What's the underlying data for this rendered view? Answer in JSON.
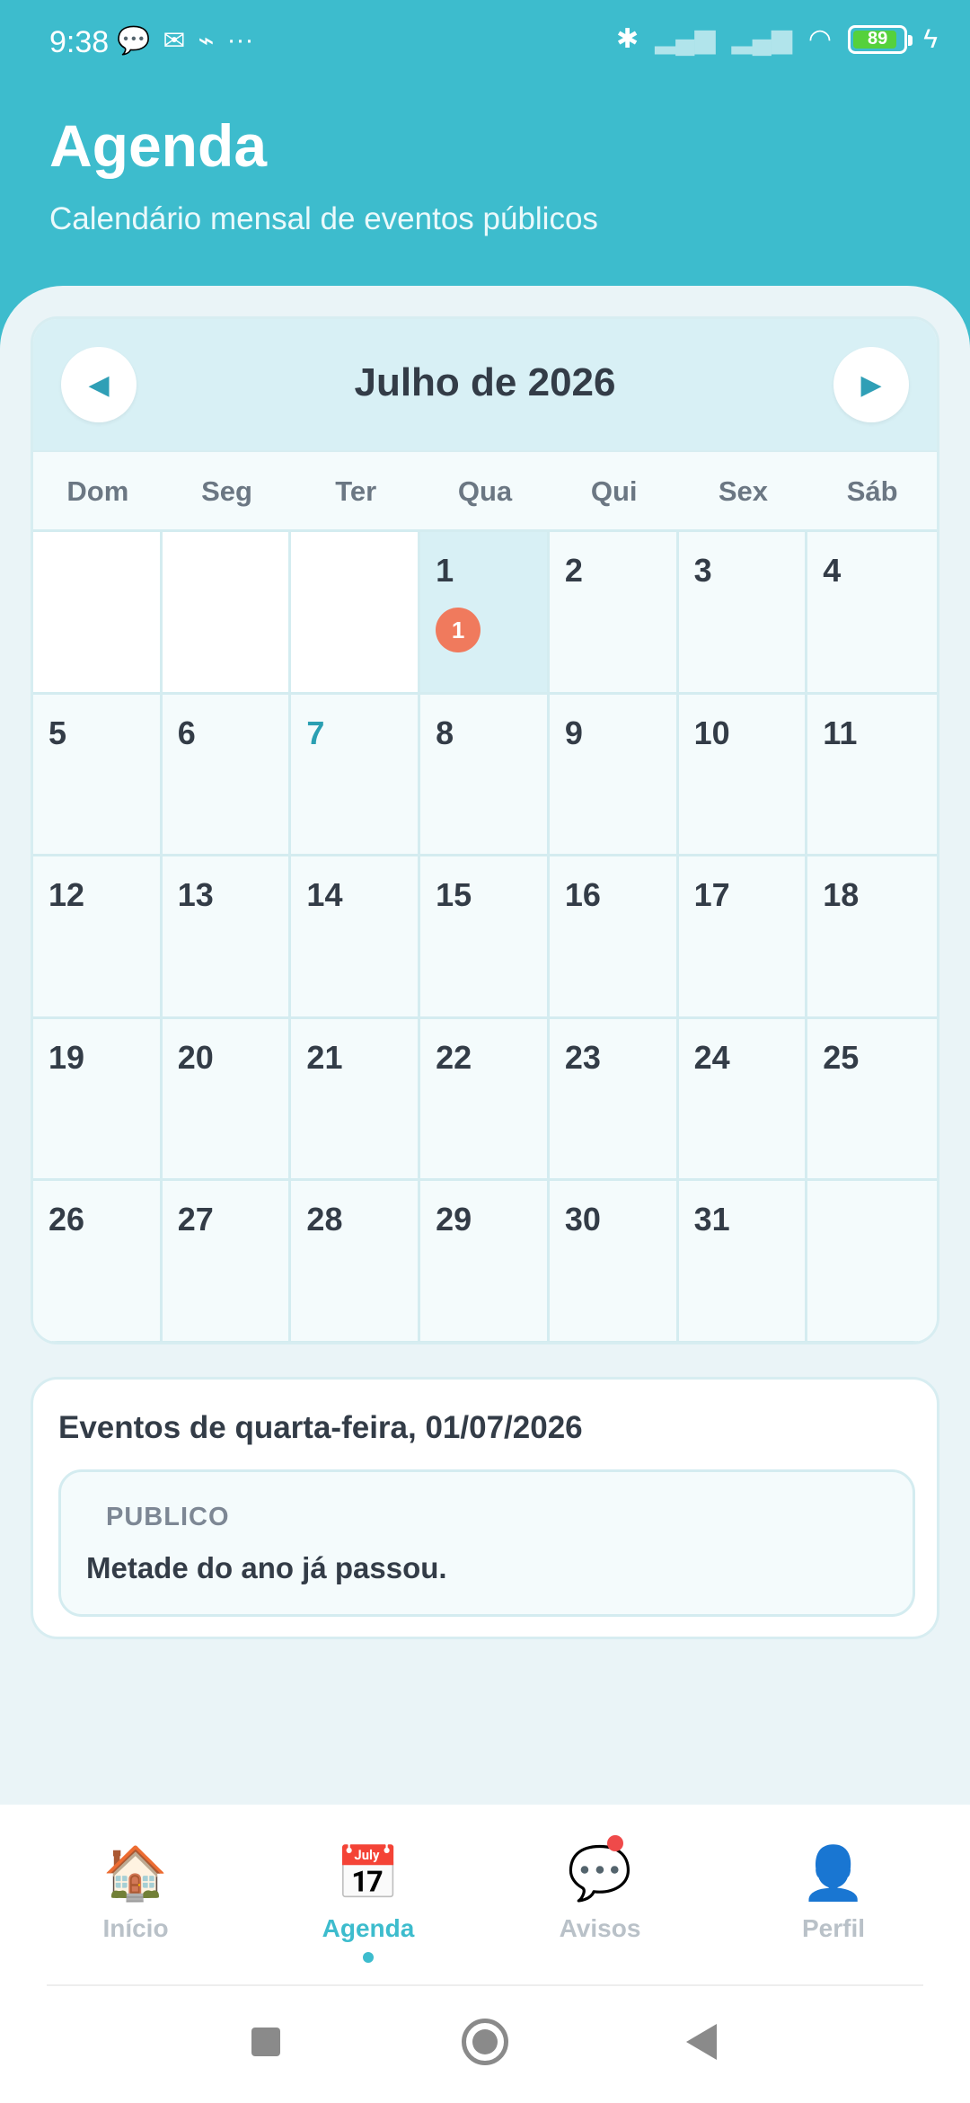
{
  "status_bar": {
    "time": "9:38",
    "battery": "89"
  },
  "header": {
    "title": "Agenda",
    "subtitle": "Calendário mensal de eventos públicos"
  },
  "calendar": {
    "month_label": "Julho de 2026",
    "prev_icon": "◀",
    "next_icon": "▶",
    "weekdays": [
      "Dom",
      "Seg",
      "Ter",
      "Qua",
      "Qui",
      "Sex",
      "Sáb"
    ],
    "days": [
      [
        "",
        "",
        "",
        "1",
        "2",
        "3",
        "4"
      ],
      [
        "5",
        "6",
        "7",
        "8",
        "9",
        "10",
        "11"
      ],
      [
        "12",
        "13",
        "14",
        "15",
        "16",
        "17",
        "18"
      ],
      [
        "19",
        "20",
        "21",
        "22",
        "23",
        "24",
        "25"
      ],
      [
        "26",
        "27",
        "28",
        "29",
        "30",
        "31",
        ""
      ]
    ],
    "selected_day": "1",
    "today": "7",
    "event_count_badge": "1"
  },
  "events": {
    "title": "Eventos de quarta-feira, 01/07/2026",
    "items": [
      {
        "tag": "PUBLICO",
        "text": "Metade do ano já passou."
      }
    ]
  },
  "bottom_nav": {
    "items": [
      {
        "label": "Início",
        "icon": "🏠"
      },
      {
        "label": "Agenda",
        "icon": "📅"
      },
      {
        "label": "Avisos",
        "icon": "💬"
      },
      {
        "label": "Perfil",
        "icon": "👤"
      }
    ],
    "active_index": 1
  },
  "colors": {
    "accent": "#3dbccd",
    "badge": "#f07a5d",
    "notification": "#ef4a4a"
  }
}
